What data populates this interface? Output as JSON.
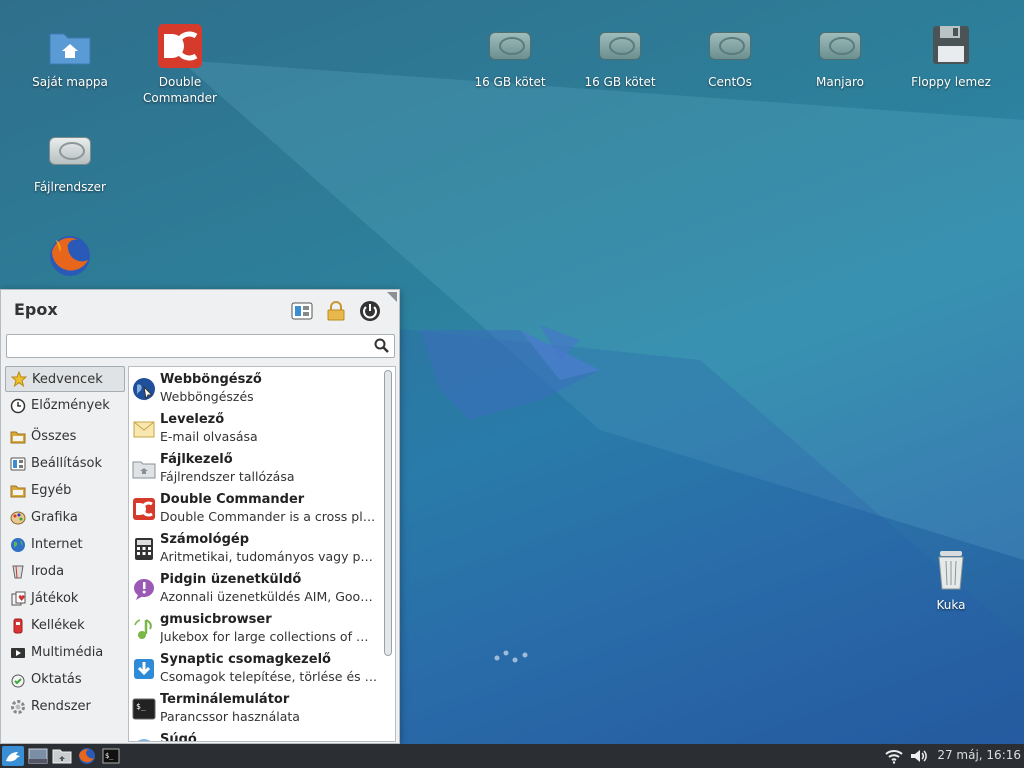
{
  "desktop": {
    "icons": [
      {
        "label": "Saját mappa",
        "icon": "home-folder-icon"
      },
      {
        "label": "Double Commander",
        "icon": "double-commander-icon"
      },
      {
        "label": "16 GB kötet",
        "icon": "drive-icon"
      },
      {
        "label": "16 GB kötet",
        "icon": "drive-icon"
      },
      {
        "label": "CentOs",
        "icon": "drive-icon"
      },
      {
        "label": "Manjaro",
        "icon": "drive-icon"
      },
      {
        "label": "Floppy lemez",
        "icon": "floppy-icon"
      },
      {
        "label": "Fájlrendszer",
        "icon": "drive-icon"
      },
      {
        "label": "",
        "icon": "firefox-icon"
      },
      {
        "label": "Kuka",
        "icon": "trash-icon"
      }
    ]
  },
  "menu": {
    "title": "Epox",
    "search_placeholder": "",
    "categories": [
      {
        "label": "Kedvencek",
        "icon": "star-icon"
      },
      {
        "label": "Előzmények",
        "icon": "history-icon"
      },
      {
        "label": "Összes",
        "icon": "folder-icon"
      },
      {
        "label": "Beállítások",
        "icon": "settings-icon"
      },
      {
        "label": "Egyéb",
        "icon": "folder-icon"
      },
      {
        "label": "Grafika",
        "icon": "palette-icon"
      },
      {
        "label": "Internet",
        "icon": "globe-icon"
      },
      {
        "label": "Iroda",
        "icon": "office-icon"
      },
      {
        "label": "Játékok",
        "icon": "games-icon"
      },
      {
        "label": "Kellékek",
        "icon": "accessories-icon"
      },
      {
        "label": "Multimédia",
        "icon": "multimedia-icon"
      },
      {
        "label": "Oktatás",
        "icon": "education-icon"
      },
      {
        "label": "Rendszer",
        "icon": "system-gear-icon"
      }
    ],
    "apps": [
      {
        "name": "Webböngésző",
        "desc": "Webböngészés",
        "icon": "web-browser-icon"
      },
      {
        "name": "Levelező",
        "desc": "E-mail olvasása",
        "icon": "mail-icon"
      },
      {
        "name": "Fájlkezelő",
        "desc": "Fájlrendszer tallózása",
        "icon": "file-manager-icon"
      },
      {
        "name": "Double Commander",
        "desc": "Double Commander is a cross platf…",
        "icon": "double-commander-icon"
      },
      {
        "name": "Számológép",
        "desc": "Aritmetikai, tudományos vagy pén…",
        "icon": "calculator-icon"
      },
      {
        "name": "Pidgin üzenetküldő",
        "desc": "Azonnali üzenetküldés AIM, Googl…",
        "icon": "pidgin-icon"
      },
      {
        "name": "gmusicbrowser",
        "desc": "Jukebox for large collections of mp…",
        "icon": "music-icon"
      },
      {
        "name": "Synaptic csomagkezelő",
        "desc": "Csomagok telepítése, törlése és fri…",
        "icon": "package-icon"
      },
      {
        "name": "Terminálemulátor",
        "desc": "Parancssor használata",
        "icon": "terminal-icon"
      },
      {
        "name": "Súgó",
        "desc": "",
        "icon": "help-icon"
      }
    ]
  },
  "panel": {
    "clock": "27 máj, 16:16",
    "colors": {
      "panel_bg": "#2b2f33",
      "accent": "#3a8fd4"
    }
  }
}
